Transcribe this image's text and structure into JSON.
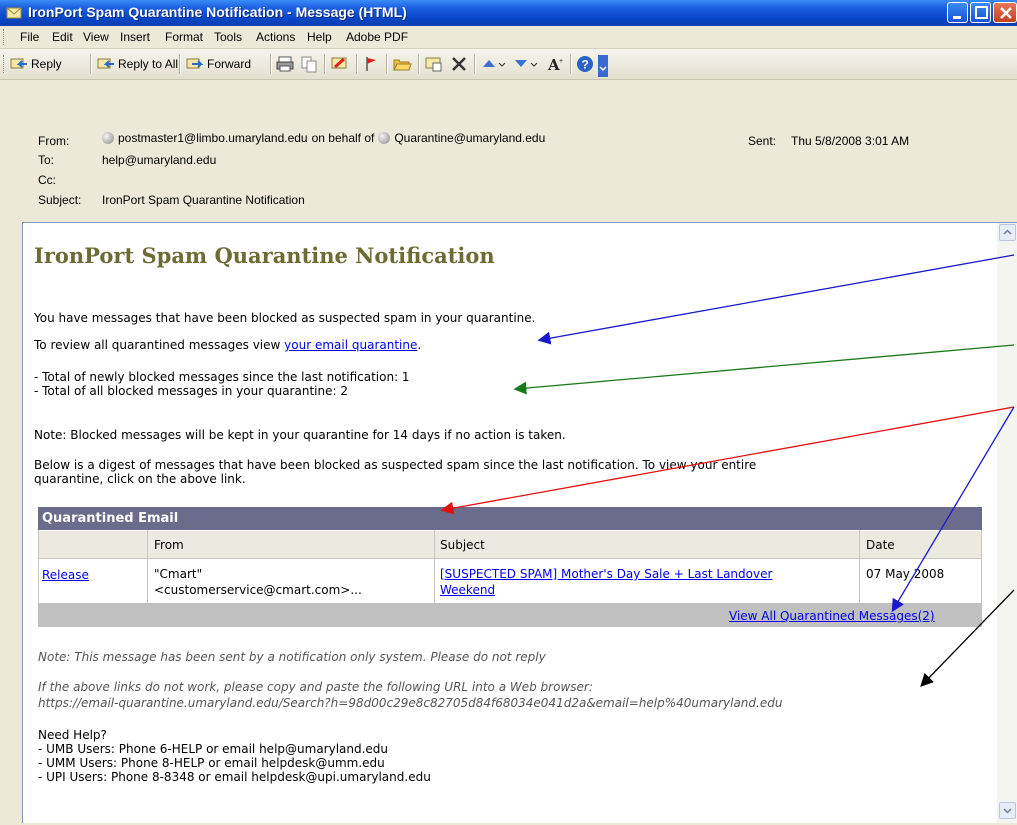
{
  "window": {
    "title": "IronPort Spam Quarantine Notification - Message (HTML)"
  },
  "menu": [
    "File",
    "Edit",
    "View",
    "Insert",
    "Format",
    "Tools",
    "Actions",
    "Help",
    "Adobe PDF"
  ],
  "toolbar": {
    "reply": "Reply",
    "reply_all": "Reply to All",
    "forward": "Forward"
  },
  "header": {
    "from_label": "From:",
    "from_sender": "postmaster1@limbo.umaryland.edu",
    "on_behalf": "on behalf of",
    "from_owner": "Quarantine@umaryland.edu",
    "sent_label": "Sent:",
    "sent_value": "Thu 5/8/2008 3:01 AM",
    "to_label": "To:",
    "to_value": "help@umaryland.edu",
    "cc_label": "Cc:",
    "subject_label": "Subject:",
    "subject_value": "IronPort Spam Quarantine Notification"
  },
  "body": {
    "heading": "IronPort Spam Quarantine Notification",
    "intro": "You have messages that have been blocked as suspected spam in your quarantine.",
    "review_prefix": "To review all quarantined messages view",
    "review_link": "your email quarantine",
    "review_suffix": ".",
    "total_new": "- Total of newly blocked messages since the last notification: 1",
    "total_all": "- Total of all blocked messages in your quarantine: 2",
    "note_keep": "Note: Blocked messages will be kept in your quarantine for 14 days if no action is taken.",
    "digest_line1": "Below is a digest of messages that have been blocked as suspected spam since the last notification. To view your entire",
    "digest_line2": "quarantine, click on the above link.",
    "table_title": "Quarantined Email",
    "columns": [
      "",
      "From",
      "Subject",
      "Date"
    ],
    "rows": [
      {
        "action": "Release",
        "from_line1": "\"Cmart\"",
        "from_line2": "<customerservice@cmart.com>...",
        "subject_line1": "[SUSPECTED SPAM] Mother's Day Sale + Last Landover",
        "subject_line2": "Weekend",
        "date": "07 May 2008"
      }
    ],
    "view_all": "View All Quarantined Messages(2)",
    "note_noreply": "Note: This message has been sent by a notification only system. Please do not reply",
    "links_fail": "If the above links do not work, please copy and paste the following URL into a Web browser:",
    "url": "https://email-quarantine.umaryland.edu/Search?h=98d00c29e8c82705d84f68034e041d2a&email=help%40umaryland.edu",
    "need_help": "Need Help?",
    "help_umb": "- UMB Users: Phone 6-HELP or email help@umaryland.edu",
    "help_umm": "- UMM Users: Phone 8-HELP or email helpdesk@umm.edu",
    "help_upi": "- UPI Users: Phone 8-8348 or email helpdesk@upi.umaryland.edu"
  },
  "colors": {
    "title_bar": "#0a47c8",
    "heading": "#6d6b35",
    "table_header": "#6b6b8c",
    "link": "#0000ee",
    "arrow_blue": "#1a1acc",
    "arrow_green": "#1a7a1a",
    "arrow_red": "#e01010",
    "arrow_black": "#000000"
  }
}
